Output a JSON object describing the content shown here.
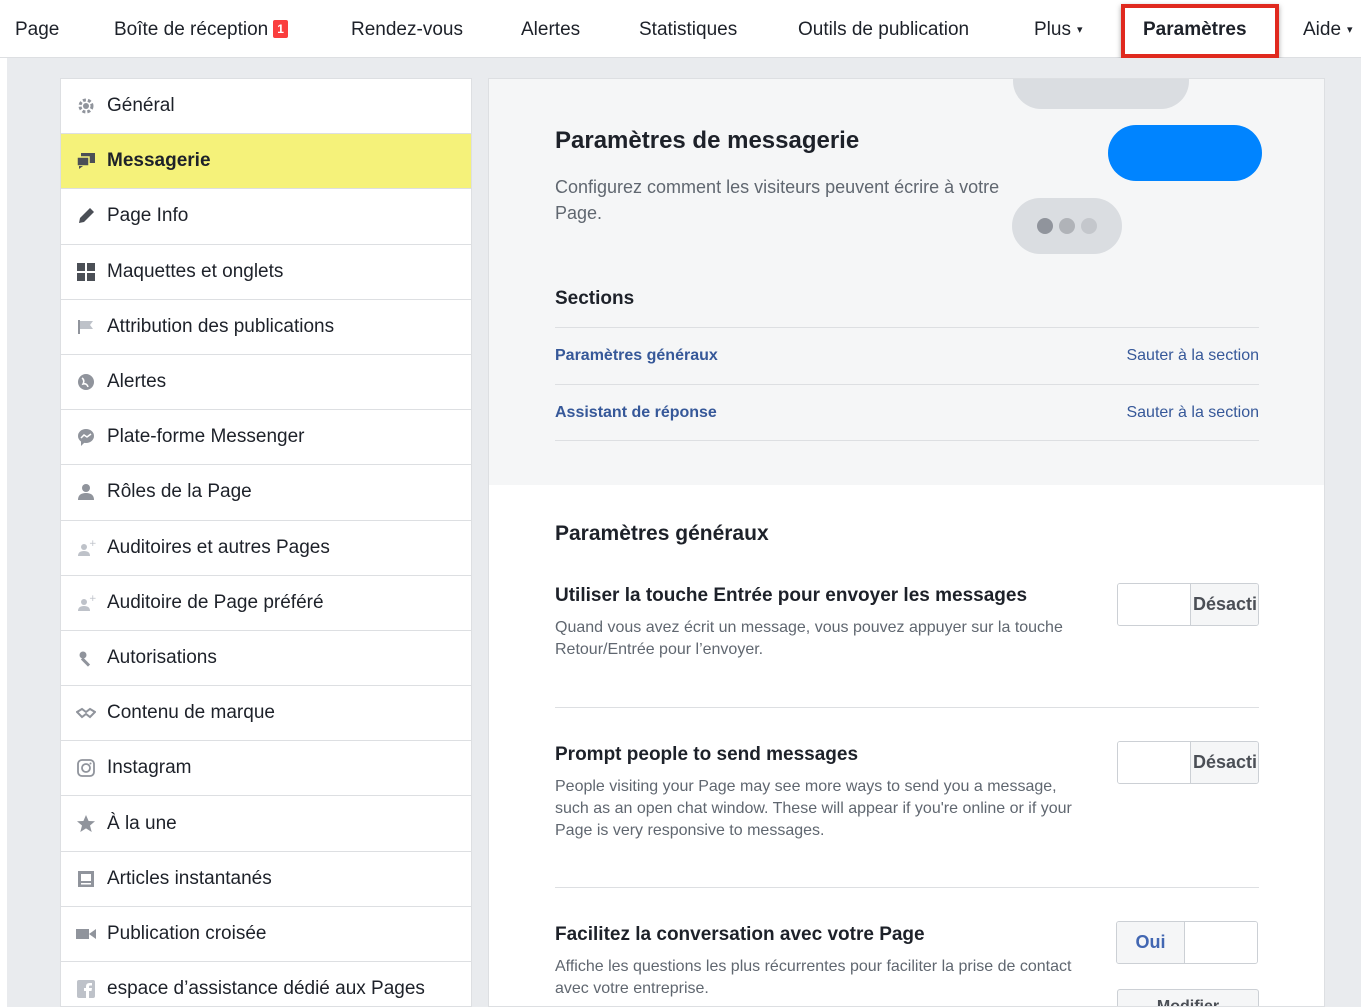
{
  "nav": {
    "items": [
      {
        "label": "Page"
      },
      {
        "label": "Boîte de réception",
        "badge": "1"
      },
      {
        "label": "Rendez-vous"
      },
      {
        "label": "Alertes"
      },
      {
        "label": "Statistiques"
      },
      {
        "label": "Outils de publication"
      },
      {
        "label": "Plus",
        "caret": "▾"
      },
      {
        "label": "Paramètres",
        "active": true
      },
      {
        "label": "Aide",
        "caret": "▾"
      }
    ]
  },
  "sidebar": {
    "items": [
      {
        "label": "Général",
        "icon": "gear-icon"
      },
      {
        "label": "Messagerie",
        "icon": "messages-icon",
        "active": true
      },
      {
        "label": "Page Info",
        "icon": "pencil-icon"
      },
      {
        "label": "Maquettes et onglets",
        "icon": "grid-icon"
      },
      {
        "label": "Attribution des publications",
        "icon": "flag-icon"
      },
      {
        "label": "Alertes",
        "icon": "globe-icon"
      },
      {
        "label": "Plate-forme Messenger",
        "icon": "messenger-icon"
      },
      {
        "label": "Rôles de la Page",
        "icon": "person-icon"
      },
      {
        "label": "Auditoires et autres Pages",
        "icon": "person-plus-icon"
      },
      {
        "label": "Auditoire de Page préféré",
        "icon": "person-plus-icon"
      },
      {
        "label": "Autorisations",
        "icon": "wrench-icon"
      },
      {
        "label": "Contenu de marque",
        "icon": "handshake-icon"
      },
      {
        "label": "Instagram",
        "icon": "instagram-icon"
      },
      {
        "label": "À la une",
        "icon": "star-icon"
      },
      {
        "label": "Articles instantanés",
        "icon": "article-icon"
      },
      {
        "label": "Publication croisée",
        "icon": "video-icon"
      },
      {
        "label": "espace d’assistance dédié aux Pages",
        "icon": "facebook-icon"
      }
    ]
  },
  "main": {
    "title": "Paramètres de messagerie",
    "subtitle": "Configurez comment les visiteurs peuvent écrire à votre Page.",
    "sections_title": "Sections",
    "sections": [
      {
        "label": "Paramètres généraux",
        "jump": "Sauter à la section"
      },
      {
        "label": "Assistant de réponse",
        "jump": "Sauter à la section"
      }
    ],
    "general_title": "Paramètres généraux",
    "settings": [
      {
        "title": "Utiliser la touche Entrée pour envoyer les messages",
        "desc": "Quand vous avez écrit un message, vous pouvez appuyer sur la touche Retour/Entrée pour l’envoyer.",
        "toggle": "Désacti"
      },
      {
        "title": "Prompt people to send messages",
        "desc": "People visiting your Page may see more ways to send you a message, such as an open chat window. These will appear if you're online or if your Page is very responsive to messages.",
        "toggle": "Désacti"
      },
      {
        "title": "Facilitez la conversation avec votre Page",
        "desc": "Affiche les questions les plus récurrentes pour faciliter la prise de contact avec votre entreprise.",
        "toggle": "Oui",
        "edit": "Modifier"
      }
    ]
  },
  "colors": {
    "accent_blue": "#0084ff",
    "link": "#365899",
    "active_highlight": "#f5f27a",
    "callout_border": "#e0291e"
  }
}
